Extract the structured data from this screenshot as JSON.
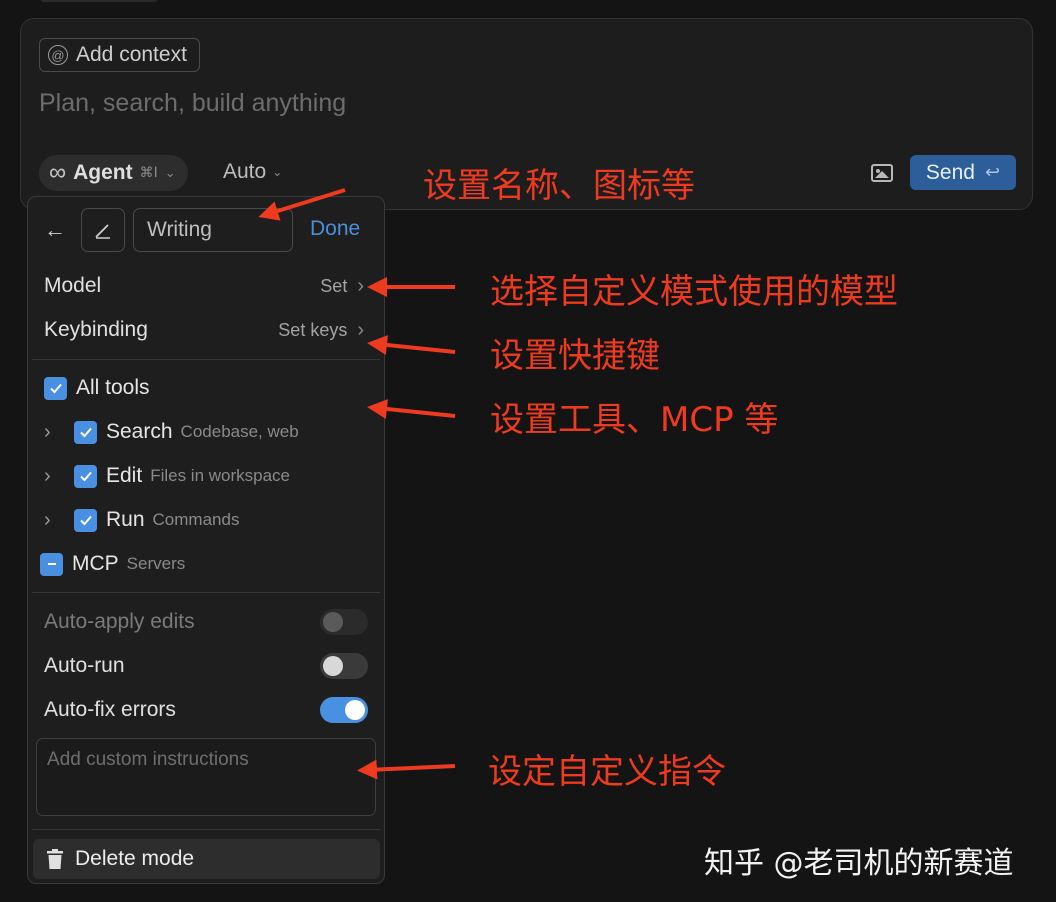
{
  "composer": {
    "add_context_label": "Add context",
    "input_placeholder": "Plan, search, build anything",
    "mode_label": "Agent",
    "mode_shortcut": "⌘I",
    "model_label": "Auto",
    "send_label": "Send"
  },
  "mode_editor": {
    "name_value": "Writing",
    "done_label": "Done",
    "model_row": {
      "label": "Model",
      "value": "Set"
    },
    "keybinding_row": {
      "label": "Keybinding",
      "value": "Set keys"
    },
    "tools": {
      "all_label": "All tools",
      "items": [
        {
          "label": "Search",
          "desc": "Codebase, web"
        },
        {
          "label": "Edit",
          "desc": "Files in workspace"
        },
        {
          "label": "Run",
          "desc": "Commands"
        }
      ],
      "mcp": {
        "label": "MCP",
        "desc": "Servers"
      }
    },
    "toggles": {
      "auto_apply": {
        "label": "Auto-apply edits",
        "on": false,
        "disabled": true
      },
      "auto_run": {
        "label": "Auto-run",
        "on": false
      },
      "auto_fix": {
        "label": "Auto-fix errors",
        "on": true
      }
    },
    "instructions_placeholder": "Add custom instructions",
    "delete_label": "Delete mode"
  },
  "annotations": {
    "name_icon": "设置名称、图标等",
    "model": "选择自定义模式使用的模型",
    "keybinding": "设置快捷键",
    "tools": "设置工具、MCP 等",
    "instructions": "设定自定义指令"
  },
  "watermark": "知乎 @老司机的新赛道",
  "colors": {
    "accent": "#4a90e2",
    "send_bg": "#2d5e99",
    "annotation": "#ee3a1f",
    "background": "#141414"
  }
}
